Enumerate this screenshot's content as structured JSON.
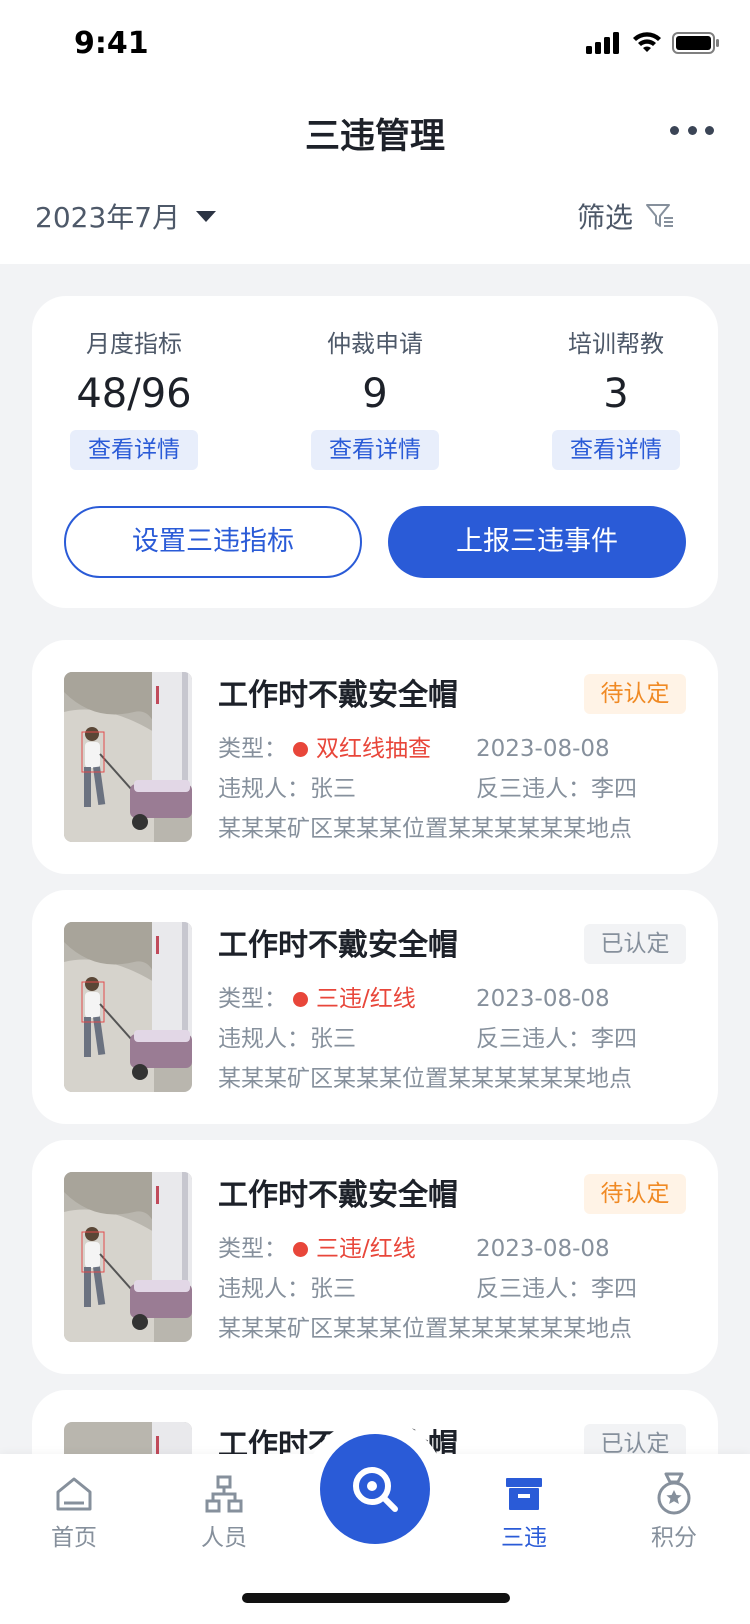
{
  "status": {
    "time": "9:41"
  },
  "header": {
    "title": "三违管理"
  },
  "filter": {
    "month": "2023年7月",
    "filter_label": "筛选"
  },
  "summary": {
    "stats": [
      {
        "label": "月度指标",
        "value": "48/96",
        "link": "查看详情"
      },
      {
        "label": "仲裁申请",
        "value": "9",
        "link": "查看详情"
      },
      {
        "label": "培训帮教",
        "value": "3",
        "link": "查看详情"
      }
    ],
    "set_button": "设置三违指标",
    "report_button": "上报三违事件"
  },
  "events": [
    {
      "title": "工作时不戴安全帽",
      "status": "待认定",
      "type_label": "类型：",
      "type_value": "双红线抽查",
      "date": "2023-08-08",
      "violator_label": "违规人：",
      "violator": "张三",
      "reporter_label": "反三违人：",
      "reporter": "李四",
      "location": "某某某矿区某某某位置某某某某某某地点"
    },
    {
      "title": "工作时不戴安全帽",
      "status": "已认定",
      "type_label": "类型：",
      "type_value": "三违/红线",
      "date": "2023-08-08",
      "violator_label": "违规人：",
      "violator": "张三",
      "reporter_label": "反三违人：",
      "reporter": "李四",
      "location": "某某某矿区某某某位置某某某某某某地点"
    },
    {
      "title": "工作时不戴安全帽",
      "status": "待认定",
      "type_label": "类型：",
      "type_value": "三违/红线",
      "date": "2023-08-08",
      "violator_label": "违规人：",
      "violator": "张三",
      "reporter_label": "反三违人：",
      "reporter": "李四",
      "location": "某某某矿区某某某位置某某某某某某地点"
    },
    {
      "title": "工作时不戴安全帽",
      "status": "已认定"
    }
  ],
  "tabs": [
    {
      "label": "首页",
      "icon": "home-icon"
    },
    {
      "label": "人员",
      "icon": "org-icon"
    },
    {
      "label": "三违",
      "icon": "box-icon",
      "active": true
    },
    {
      "label": "积分",
      "icon": "medal-icon"
    }
  ],
  "colors": {
    "primary": "#2a5bd7",
    "danger": "#e8463a",
    "pending": "#f08a24"
  }
}
